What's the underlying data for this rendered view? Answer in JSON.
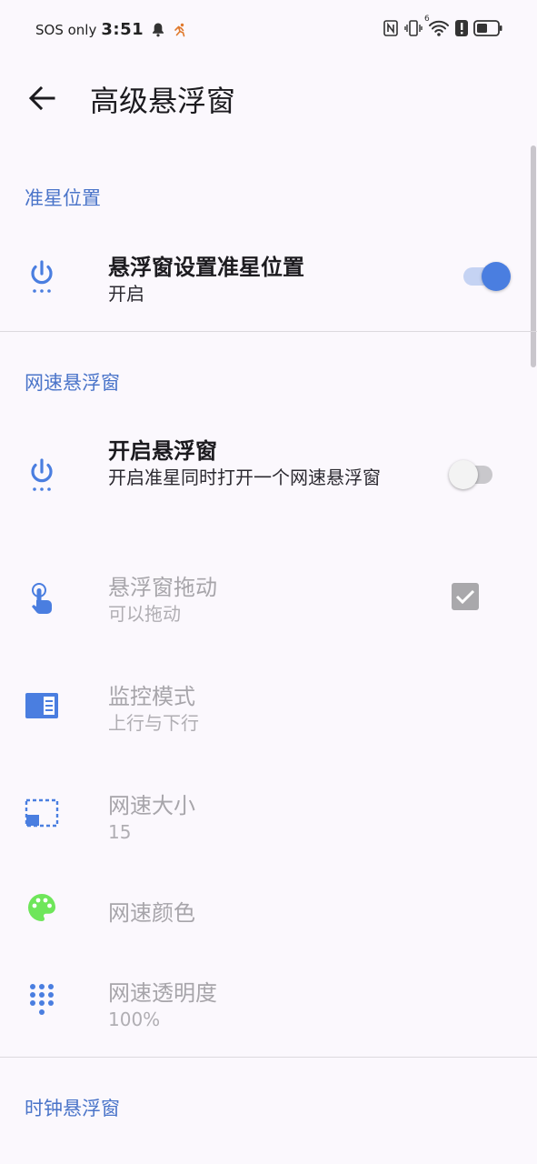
{
  "status_bar": {
    "carrier": "SOS only",
    "time": "3:51",
    "network_superscript": "6"
  },
  "app_bar": {
    "title": "高级悬浮窗"
  },
  "sections": {
    "crosshair": {
      "title": "准星位置",
      "items": [
        {
          "title": "悬浮窗设置准星位置",
          "summary": "开启",
          "control": "switch",
          "checked": true
        }
      ]
    },
    "netspeed": {
      "title": "网速悬浮窗",
      "items": [
        {
          "title": "开启悬浮窗",
          "summary": "开启准星同时打开一个网速悬浮窗",
          "control": "switch",
          "checked": false
        },
        {
          "title": "悬浮窗拖动",
          "summary": "可以拖动",
          "control": "checkbox",
          "checked": true,
          "enabled": false
        },
        {
          "title": "监控模式",
          "summary": "上行与下行",
          "enabled": false
        },
        {
          "title": "网速大小",
          "summary": "15",
          "enabled": false
        },
        {
          "title": "网速颜色",
          "enabled": false
        },
        {
          "title": "网速透明度",
          "summary": "100%",
          "enabled": false
        }
      ]
    },
    "clock": {
      "title": "时钟悬浮窗"
    }
  },
  "colors": {
    "accent": "#4a7ee0",
    "section_title": "#4a74c9",
    "palette_icon": "#6ee65a",
    "background": "#fbf8fd"
  }
}
